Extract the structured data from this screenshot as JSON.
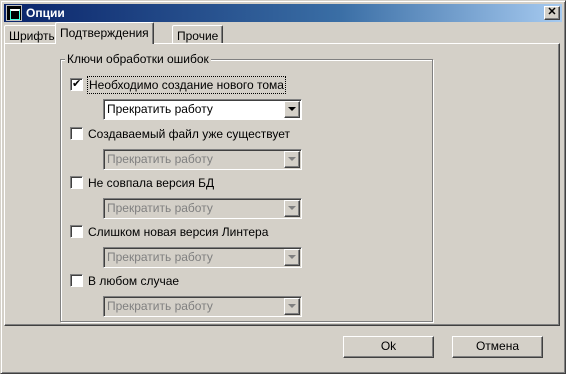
{
  "window": {
    "title": "Опции",
    "app_icon": "terminal-app-icon",
    "close_label": "✕"
  },
  "tabs": [
    {
      "label": "Шрифты",
      "active": false
    },
    {
      "label": "Подтверждения",
      "active": true
    },
    {
      "label": "Прочие",
      "active": false
    }
  ],
  "group": {
    "title": "Ключи обработки ошибок",
    "options": [
      {
        "label": "Необходимо создание нового тома",
        "checked": true,
        "select_value": "Прекратить работу",
        "select_enabled": true
      },
      {
        "label": "Создаваемый файл уже существует",
        "checked": false,
        "select_value": "Прекратить работу",
        "select_enabled": false
      },
      {
        "label": "Не совпала версия БД",
        "checked": false,
        "select_value": "Прекратить работу",
        "select_enabled": false
      },
      {
        "label": "Слишком новая версия Линтера",
        "checked": false,
        "select_value": "Прекратить работу",
        "select_enabled": false
      },
      {
        "label": "В любом случае",
        "checked": false,
        "select_value": "Прекратить работу",
        "select_enabled": false
      }
    ]
  },
  "buttons": {
    "ok_label": "Ok",
    "cancel_label": "Отмена"
  }
}
